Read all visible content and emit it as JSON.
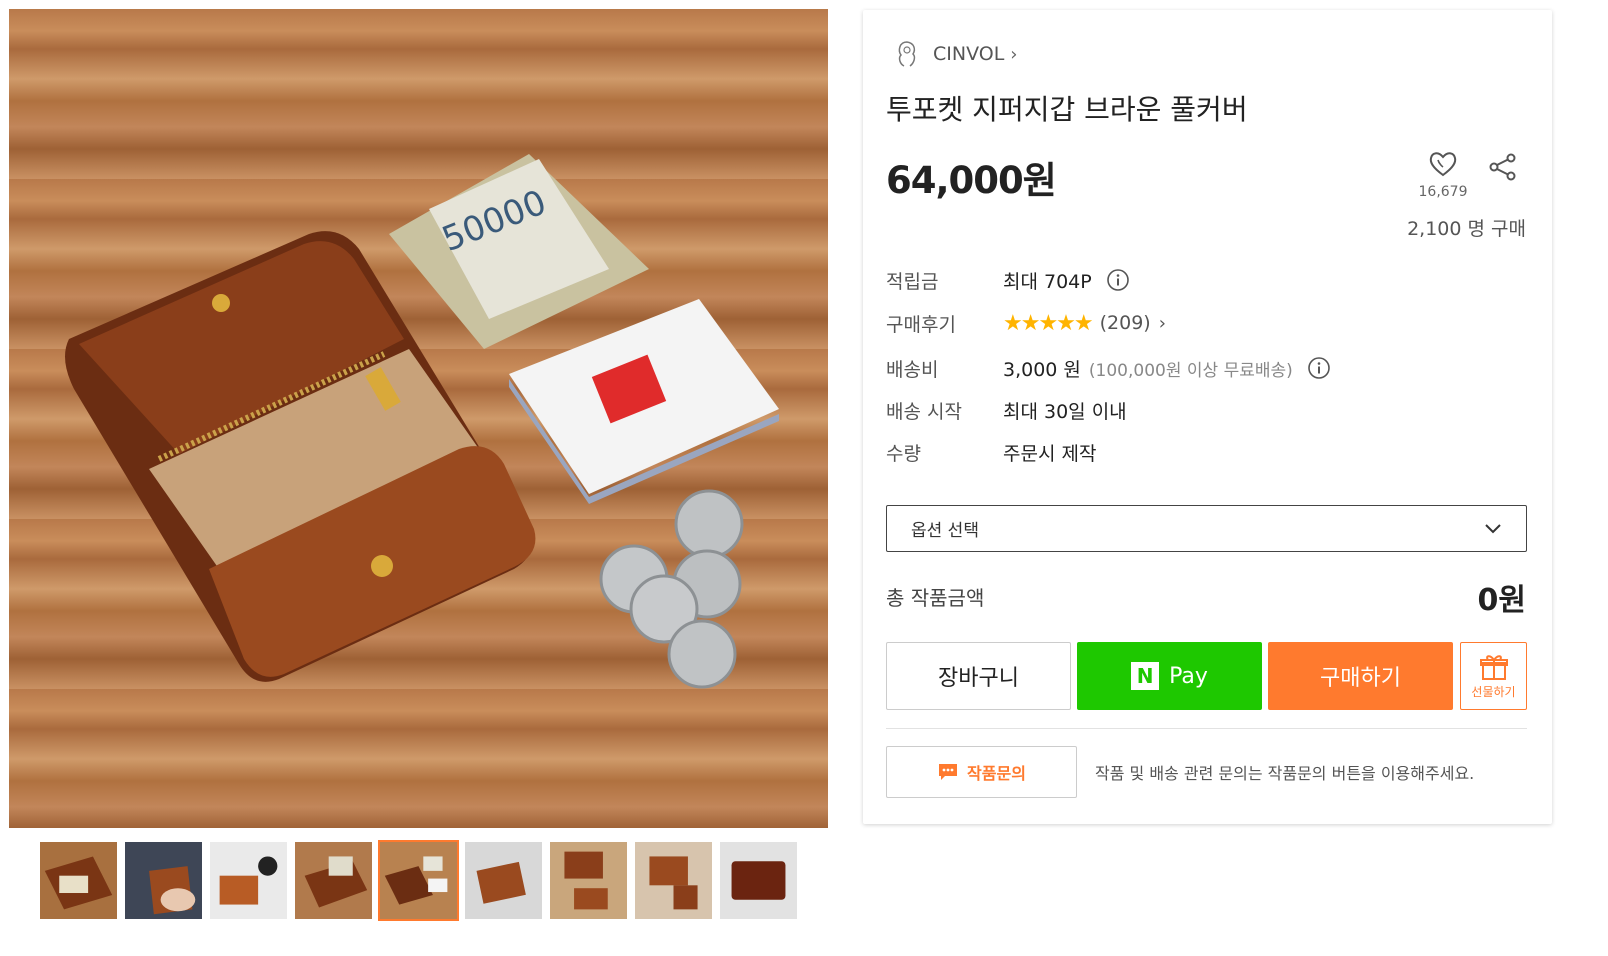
{
  "gallery": {
    "thumbnail_count": 9,
    "active_thumbnail": 5
  },
  "seller": {
    "name": "CINVOL",
    "chevron": "›"
  },
  "product": {
    "title": "투포켓 지퍼지갑 브라운 풀커버",
    "price": "64,000원",
    "likes": "16,679",
    "buyers": "2,100 명 구매"
  },
  "info": {
    "points_label": "적립금",
    "points_value": "최대 704P",
    "review_label": "구매후기",
    "review_stars": "★★★★★",
    "review_rating": 5,
    "review_count": "(209)",
    "shipping_label": "배송비",
    "shipping_value": "3,000 원",
    "shipping_note": "(100,000원 이상 무료배송)",
    "ship_start_label": "배송 시작",
    "ship_start_value": "최대 30일 이내",
    "qty_label": "수량",
    "qty_value": "주문시 제작"
  },
  "option": {
    "placeholder": "옵션 선택"
  },
  "total": {
    "label": "총 작품금액",
    "value": "0원"
  },
  "buttons": {
    "cart": "장바구니",
    "npay_logo": "N",
    "npay": "Pay",
    "buy": "구매하기",
    "gift": "선물하기"
  },
  "inquiry": {
    "button": "작품문의",
    "note": "작품 및 배송 관련 문의는 작품문의 버튼을 이용해주세요."
  },
  "colors": {
    "accent": "#ff7a2e",
    "npay": "#1ec800",
    "star": "#ffb400"
  }
}
